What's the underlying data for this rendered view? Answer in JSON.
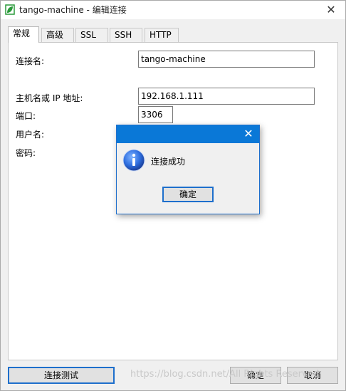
{
  "window": {
    "title": "tango-machine - 编辑连接",
    "close_glyph": "✕"
  },
  "tabs": [
    {
      "label": "常规",
      "active": true
    },
    {
      "label": "高级",
      "active": false
    },
    {
      "label": "SSL",
      "active": false
    },
    {
      "label": "SSH",
      "active": false
    },
    {
      "label": "HTTP",
      "active": false
    }
  ],
  "form": {
    "conn_name_label": "连接名:",
    "conn_name_value": "tango-machine",
    "host_label": "主机名或 IP 地址:",
    "host_value": "192.168.1.111",
    "port_label": "端口:",
    "port_value": "3306",
    "user_label": "用户名:",
    "password_label": "密码:"
  },
  "dialog": {
    "message": "连接成功",
    "ok_label": "确定",
    "close_glyph": "✕",
    "icon": "info-icon"
  },
  "buttons": {
    "test_label": "连接测试",
    "ok_label": "确定",
    "cancel_label": "取消"
  },
  "watermark": "https://blog.csdn.net/All Rights Reserved",
  "colors": {
    "accent": "#0a78d7",
    "app_icon": "#2a9a3a"
  }
}
